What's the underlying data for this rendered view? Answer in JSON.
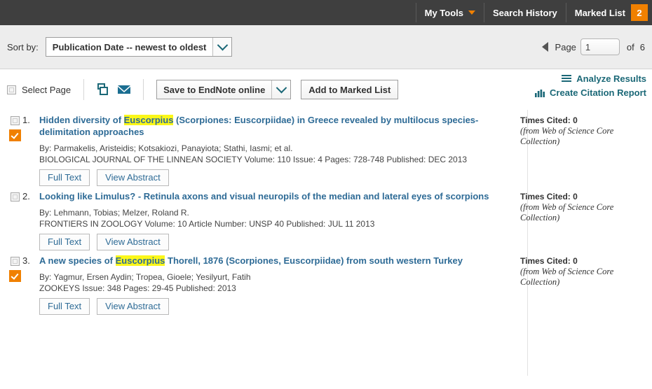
{
  "topnav": {
    "items": [
      {
        "label": "My Tools",
        "has_caret": true
      },
      {
        "label": "Search History",
        "has_caret": false
      },
      {
        "label": "Marked List",
        "has_caret": false
      }
    ],
    "marked_list_count": "2",
    "bar_color": "#3f3f3f",
    "accent_color": "#f08000"
  },
  "sortbar": {
    "label": "Sort by:",
    "selected_option": "Publication Date -- newest to oldest",
    "pager": {
      "page_word": "Page",
      "page_value": "1",
      "of_word": "of",
      "total_pages": "6"
    }
  },
  "toolbar": {
    "select_page_label": "Select Page",
    "print_icon": "print-icon",
    "email_icon": "email-icon",
    "endnote_label": "Save to EndNote online",
    "add_marked_label": "Add to Marked List",
    "analyze_label": "Analyze Results",
    "citation_report_label": "Create Citation Report",
    "link_color": "#1b6877"
  },
  "results": [
    {
      "number": "1.",
      "checked_badge": true,
      "title_parts": [
        {
          "text": "Hidden diversity of ",
          "highlight": false
        },
        {
          "text": "Euscorpius",
          "highlight": true
        },
        {
          "text": " (Scorpiones: Euscorpiidae) in Greece revealed by multilocus species-delimitation approaches",
          "highlight": false
        }
      ],
      "authors": "By: Parmakelis, Aristeidis; Kotsakiozi, Panayiota; Stathi, Iasmi; et al.",
      "source": "BIOLOGICAL JOURNAL OF THE LINNEAN SOCIETY  Volume: 110   Issue: 4   Pages: 728-748   Published: DEC 2013",
      "buttons": [
        "Full Text",
        "View Abstract"
      ],
      "times_cited": "Times Cited: 0",
      "times_cited_source": "(from Web of Science Core Collection)"
    },
    {
      "number": "2.",
      "checked_badge": false,
      "title_parts": [
        {
          "text": "Looking like Limulus? - Retinula axons and visual neuropils of the median and lateral eyes of scorpions",
          "highlight": false
        }
      ],
      "authors": "By: Lehmann, Tobias; Melzer, Roland R.",
      "source": "FRONTIERS IN ZOOLOGY  Volume: 10     Article Number: UNSP 40   Published: JUL 11 2013",
      "buttons": [
        "Full Text",
        "View Abstract"
      ],
      "times_cited": "Times Cited: 0",
      "times_cited_source": "(from Web of Science Core Collection)"
    },
    {
      "number": "3.",
      "checked_badge": true,
      "title_parts": [
        {
          "text": "A new species of ",
          "highlight": false
        },
        {
          "text": "Euscorpius",
          "highlight": true
        },
        {
          "text": " Thorell, 1876 (Scorpiones, Euscorpiidae) from south western Turkey",
          "highlight": false
        }
      ],
      "authors": "By: Yagmur, Ersen Aydin; Tropea, Gioele; Yesilyurt, Fatih",
      "source": "ZOOKEYS  Issue: 348   Pages: 29-45   Published: 2013",
      "buttons": [
        "Full Text",
        "View Abstract"
      ],
      "times_cited": "Times Cited: 0",
      "times_cited_source": "(from Web of Science Core Collection)"
    }
  ]
}
